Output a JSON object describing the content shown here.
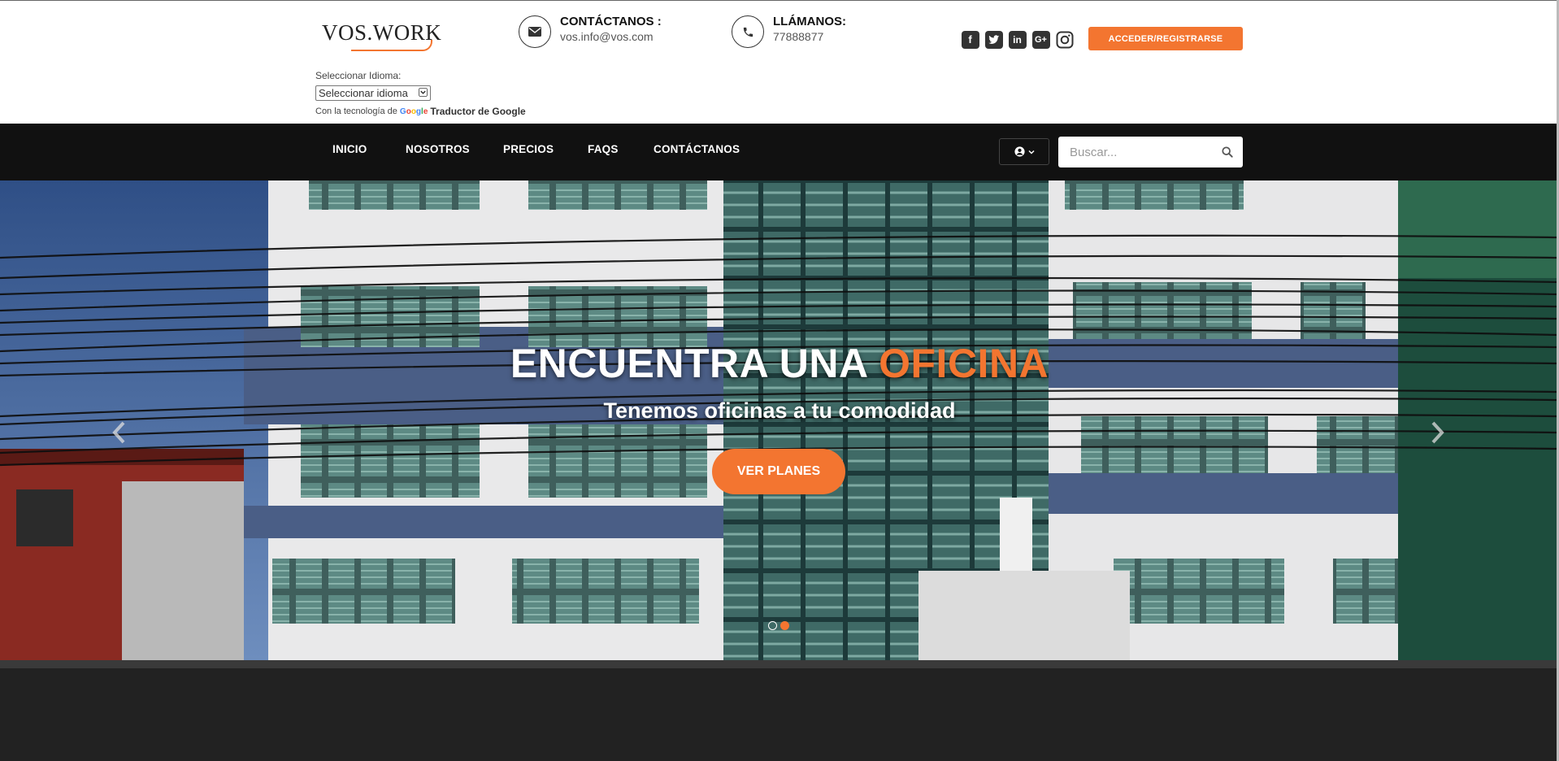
{
  "brand": {
    "logo_text": "VOS.WORK"
  },
  "contact": {
    "email_title": "CONTÁCTANOS :",
    "email_value": "vos.info@vos.com",
    "phone_title": "LLÁMANOS:",
    "phone_value": "77888877"
  },
  "socials": [
    "facebook-icon",
    "twitter-icon",
    "linkedin-icon",
    "google-plus-icon",
    "instagram-icon"
  ],
  "login_button": "ACCEDER/REGISTRARSE",
  "translate": {
    "label": "Seleccionar Idioma:",
    "select_value": "Seleccionar idioma",
    "powered_prefix": "Con la tecnología de",
    "powered_brand": "Google",
    "powered_link": "Traductor de Google"
  },
  "nav": {
    "items": [
      "INICIO",
      "NOSOTROS",
      "PRECIOS",
      "FAQS",
      "CONTÁCTANOS"
    ],
    "search_placeholder": "Buscar..."
  },
  "hero": {
    "title_main": "ENCUENTRA UNA ",
    "title_accent": "OFICINA",
    "subtitle": "Tenemos oficinas a tu comodidad",
    "button": "VER PLANES",
    "slides_total": 2,
    "active_slide": 2
  },
  "colors": {
    "accent": "#f37530",
    "nav_bg": "#111111",
    "page_bg": "#222222"
  }
}
